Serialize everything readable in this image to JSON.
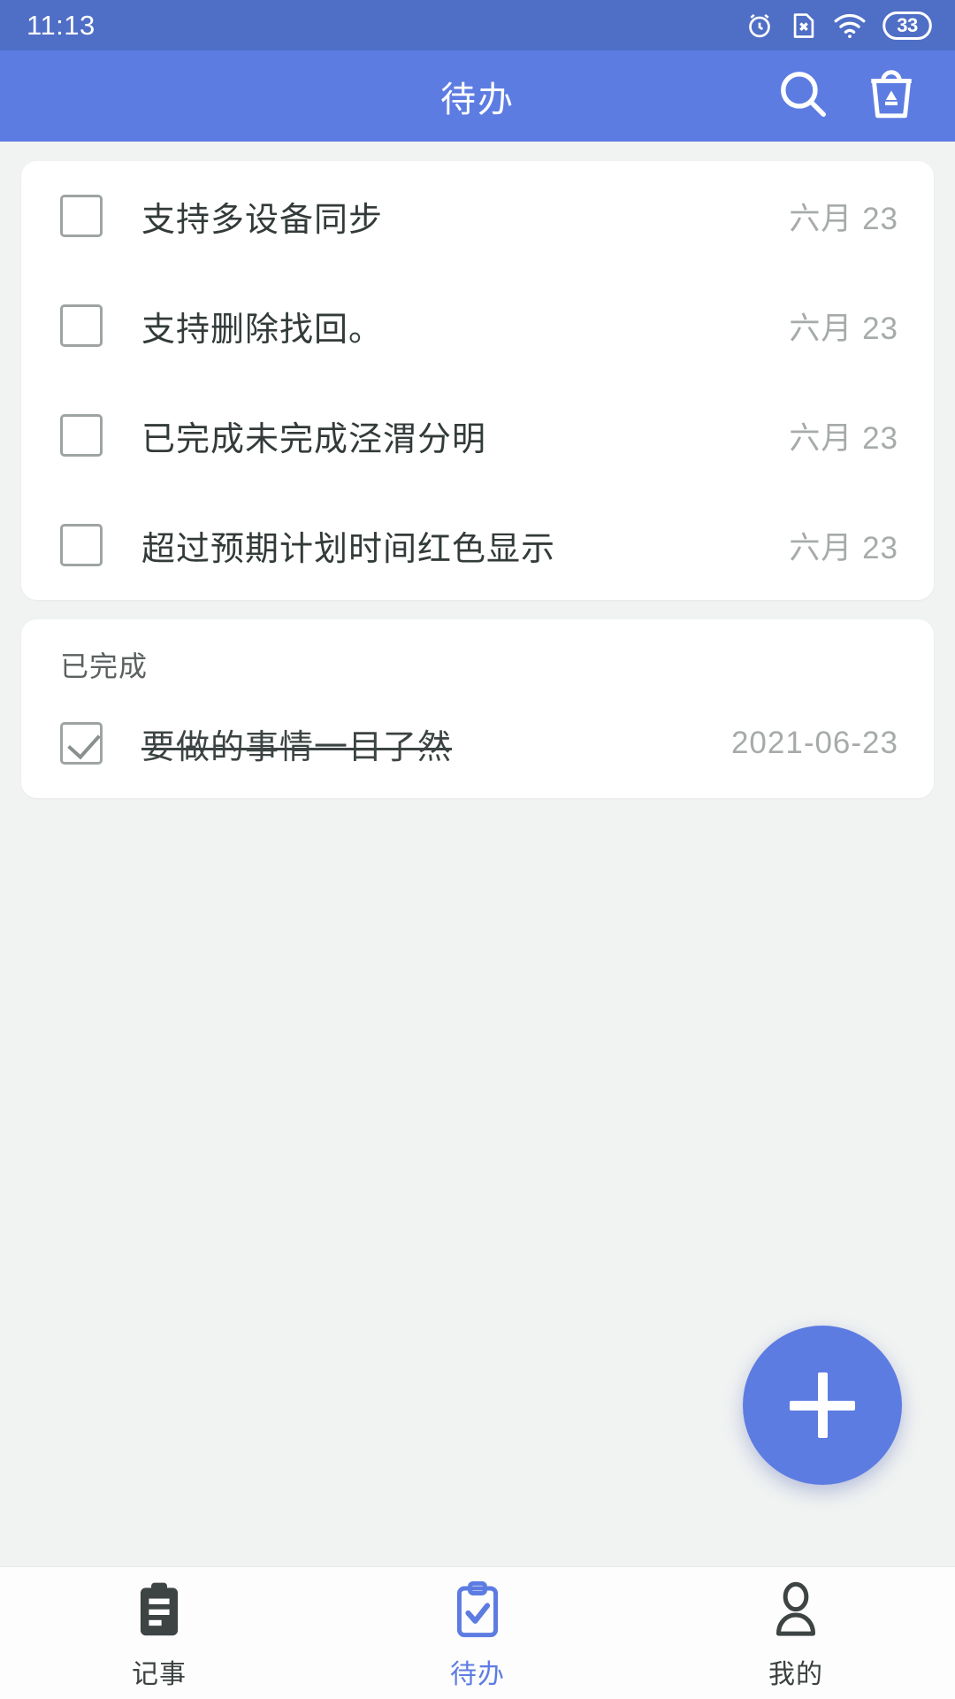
{
  "status_bar": {
    "time": "11:13",
    "battery_level": "33",
    "icons": [
      "alarm-icon",
      "no-sim-icon",
      "wifi-icon",
      "battery-icon"
    ]
  },
  "app_bar": {
    "title": "待办",
    "actions": [
      {
        "name": "search-icon",
        "label": "搜索"
      },
      {
        "name": "trash-icon",
        "label": "回收站"
      }
    ]
  },
  "theme": {
    "primary": "#5d7ce2",
    "status_bar_bg": "#4f6ec6",
    "page_bg": "#f1f3f2",
    "card_bg": "#ffffff",
    "text_primary": "#333b3a",
    "text_muted": "#a6abaa",
    "accent": "#5d7ce2"
  },
  "pending": {
    "items": [
      {
        "text": "支持多设备同步",
        "date": "六月 23",
        "checked": false
      },
      {
        "text": "支持删除找回。",
        "date": "六月 23",
        "checked": false
      },
      {
        "text": "已完成未完成泾渭分明",
        "date": "六月 23",
        "checked": false
      },
      {
        "text": "超过预期计划时间红色显示",
        "date": "六月 23",
        "checked": false
      }
    ]
  },
  "completed": {
    "section_title": "已完成",
    "items": [
      {
        "text": "要做的事情一目了然",
        "date": "2021-06-23",
        "checked": true
      }
    ]
  },
  "fab": {
    "label": "+",
    "name": "add-todo-button"
  },
  "bottom_nav": {
    "items": [
      {
        "label": "记事",
        "icon": "clipboard-lines-icon",
        "active": false
      },
      {
        "label": "待办",
        "icon": "clipboard-check-icon",
        "active": true
      },
      {
        "label": "我的",
        "icon": "person-icon",
        "active": false
      }
    ]
  }
}
